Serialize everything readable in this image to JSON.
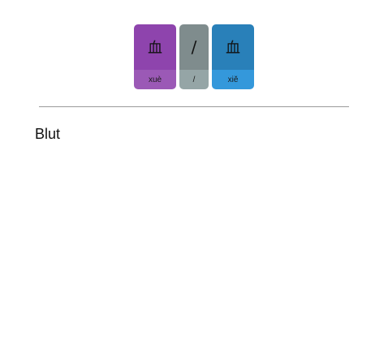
{
  "cards": [
    {
      "character": "血",
      "pinyin": "xuè",
      "color": "#8e44ad"
    },
    {
      "character": "/",
      "pinyin": "/",
      "color": "#7f8c8d"
    },
    {
      "character": "血",
      "pinyin": "xiě",
      "color": "#2980b9"
    }
  ],
  "meaning": "Blut"
}
